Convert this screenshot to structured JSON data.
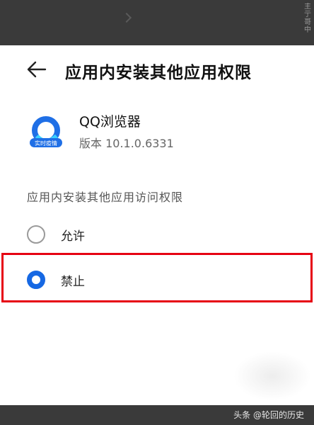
{
  "header": {
    "title": "应用内安装其他应用权限"
  },
  "app": {
    "name": "QQ浏览器",
    "version": "版本 10.1.0.6331",
    "icon_badge": "实时疫情",
    "icon_color": "#1f6fe6"
  },
  "permission": {
    "section_label": "应用内安装其他应用访问权限",
    "options": [
      {
        "label": "允许",
        "selected": false
      },
      {
        "label": "禁止",
        "selected": true
      }
    ]
  },
  "annotation": {
    "highlight_color": "#e60012"
  },
  "watermark": {
    "text": "头条 @轮回的历史"
  },
  "top_edge_text": "主\n亍\n哥\n中"
}
